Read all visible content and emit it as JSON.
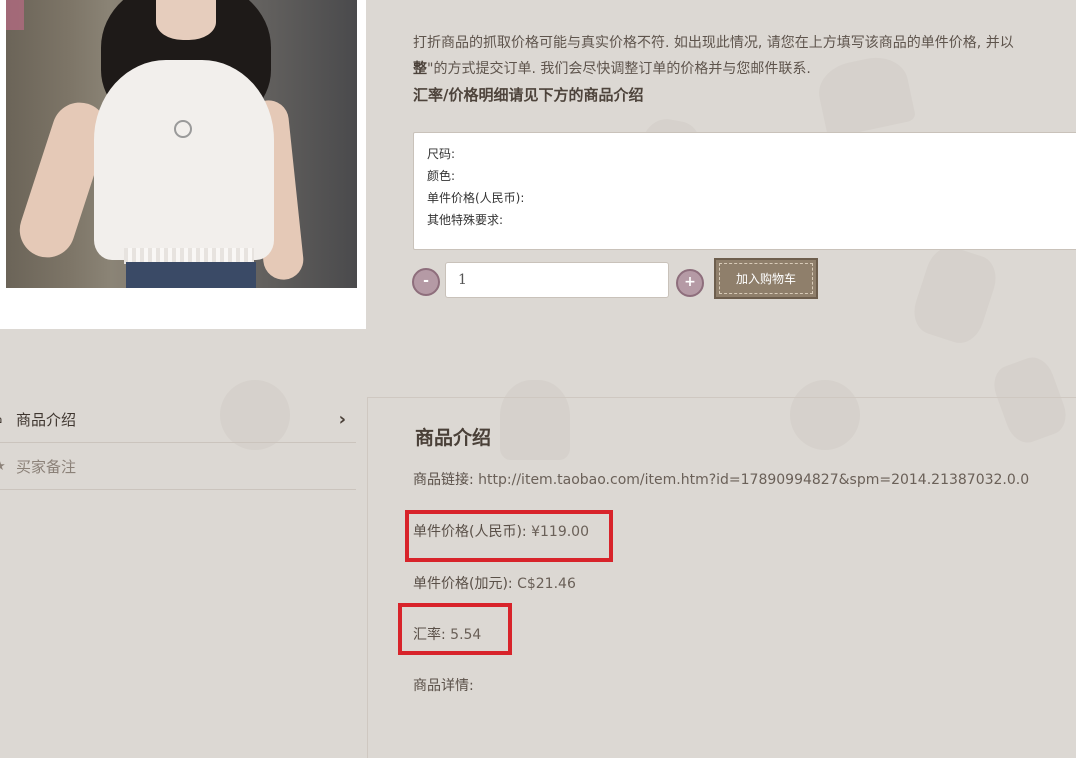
{
  "notice": {
    "line1": "打折商品的抓取价格可能与真实价格不符. 如出现此情况, 请您在上方填写该商品的单件价格, 并以",
    "line2_bold": "整",
    "line2": "\"的方式提交订单. 我们会尽快调整订单的价格并与您邮件联系.",
    "line3": "汇率/价格明细请见下方的商品介绍"
  },
  "remark": {
    "value": "尺码:\n颜色:\n单件价格(人民币):\n其他特殊要求:"
  },
  "quantity": {
    "minus_label": "-",
    "value": "1",
    "plus_label": "+"
  },
  "cart_button": "加入购物车",
  "tabs": [
    {
      "label": "商品介绍",
      "icon": "home-icon",
      "active": true
    },
    {
      "label": "买家备注",
      "icon": "star-icon",
      "active": false
    }
  ],
  "detail": {
    "title": "商品介绍",
    "link_label": "商品链接: ",
    "link_value": "http://item.taobao.com/item.htm?id=17890994827&spm=2014.21387032.0.0",
    "price_cny_label": "单件价格(人民币): ",
    "price_cny_value": "¥119.00",
    "price_cad_label": "单件价格(加元): ",
    "price_cad_value": "C$21.46",
    "rate_label": "汇率: ",
    "rate_value": "5.54",
    "details_label": "商品详情:"
  },
  "colors": {
    "background": "#dcd8d3",
    "highlight": "#d8232a",
    "cart_button": "#8f7f6b",
    "qty_button": "#b59aa5"
  }
}
